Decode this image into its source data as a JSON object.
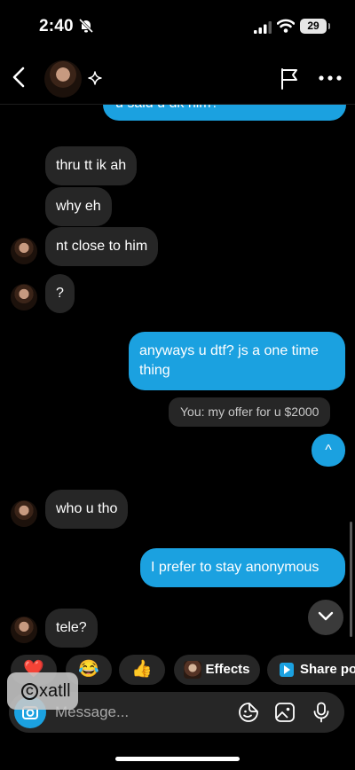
{
  "status_bar": {
    "time": "2:40",
    "battery": "29"
  },
  "messages": [
    {
      "side": "out",
      "text": "u said u dk him?"
    },
    {
      "side": "in",
      "text": "thru tt ik ah"
    },
    {
      "side": "in",
      "text": "why eh"
    },
    {
      "side": "in",
      "text": "nt close to him"
    },
    {
      "side": "in",
      "text": "?"
    },
    {
      "side": "out",
      "text": "anyways u dtf? js a one time thing"
    },
    {
      "side": "system",
      "text": "You: my offer for u $2000"
    },
    {
      "side": "out",
      "text": "^"
    },
    {
      "side": "in",
      "text": "who u tho"
    },
    {
      "side": "out",
      "text": "I prefer to stay anonymous"
    },
    {
      "side": "in",
      "text": "tele?"
    }
  ],
  "reactions": [
    {
      "type": "emoji",
      "emoji": "❤️"
    },
    {
      "type": "emoji",
      "emoji": "😂"
    },
    {
      "type": "emoji",
      "emoji": "👍"
    },
    {
      "type": "label",
      "label": "Effects"
    },
    {
      "type": "label",
      "label": "Share po"
    }
  ],
  "composer": {
    "placeholder": "Message..."
  },
  "watermark": {
    "text": "xatll"
  },
  "colors": {
    "accent": "#1ba1e0",
    "incoming_bubble": "#262626",
    "background": "#000000"
  }
}
